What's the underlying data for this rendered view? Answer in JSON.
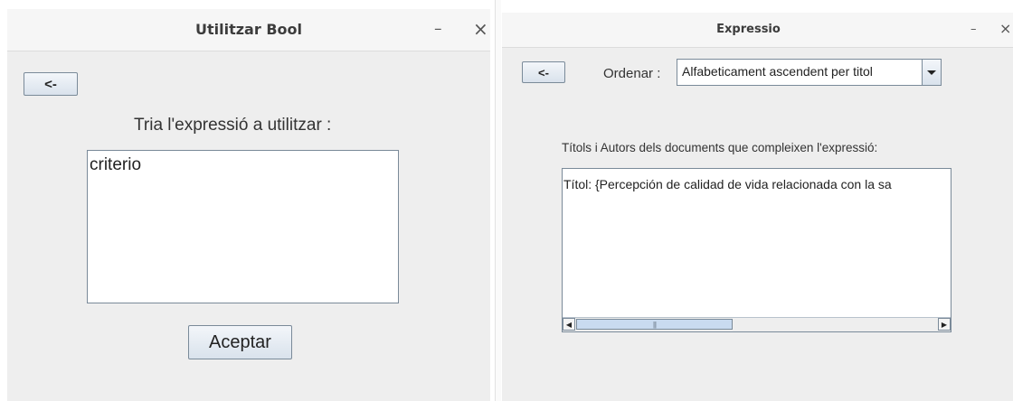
{
  "left_window": {
    "title": "Utilitzar Bool",
    "minimize_glyph": "–",
    "close_glyph": "×",
    "back_button_label": "<-",
    "prompt_label": "Tria l'expressió a utilitzar :",
    "list_items": [
      "criterio"
    ],
    "accept_button_label": "Aceptar"
  },
  "right_window": {
    "title": "Expressio",
    "minimize_glyph": "–",
    "close_glyph": "×",
    "back_button_label": "<-",
    "order_label": "Ordenar :",
    "order_selected": "Alfabeticament ascendent per titol",
    "results_label": "Títols i  Autors dels documents que compleixen l'expressió:",
    "results_text": "Títol: {Percepción de calidad de vida relacionada con la sa",
    "scroll_left_glyph": "◀",
    "scroll_right_glyph": "▶",
    "scroll_thumb_grip": "|||"
  },
  "colors": {
    "window_bg": "#eeeeee",
    "titlebar_bg": "#f6f6f6",
    "button_border": "#7a8a99",
    "scroll_thumb": "#c9dbf0"
  }
}
